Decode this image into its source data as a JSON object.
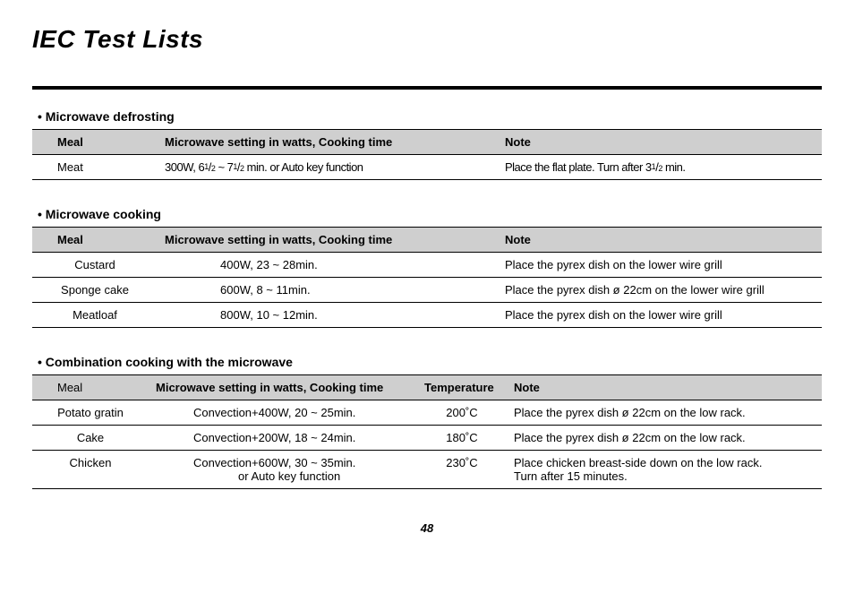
{
  "title": "IEC Test Lists",
  "page_number": "48",
  "sections": [
    {
      "heading": "• Microwave defrosting",
      "columns": [
        "Meal",
        "Microwave setting in watts, Cooking time",
        "Note"
      ],
      "rows": [
        {
          "meal": "Meat",
          "setting": "300W, 6½ ~ 7½ min. or Auto key function",
          "note": "Place the flat plate. Turn after 3½ min."
        }
      ]
    },
    {
      "heading": "• Microwave cooking",
      "columns": [
        "Meal",
        "Microwave setting in watts, Cooking time",
        "Note"
      ],
      "rows": [
        {
          "meal": "Custard",
          "setting": "400W, 23 ~ 28min.",
          "note": "Place the pyrex dish on the lower wire grill"
        },
        {
          "meal": "Sponge cake",
          "setting": "600W,  8 ~ 11min.",
          "note": "Place the pyrex dish ø 22cm on the lower wire grill"
        },
        {
          "meal": "Meatloaf",
          "setting": "800W, 10 ~ 12min.",
          "note": "Place the pyrex dish on the lower wire grill"
        }
      ]
    },
    {
      "heading": "• Combination cooking with the microwave",
      "columns": [
        "Meal",
        "Microwave setting in watts, Cooking time",
        "Temperature",
        "Note"
      ],
      "rows": [
        {
          "meal": "Potato gratin",
          "setting": "Convection+400W, 20 ~ 25min.",
          "temp": "200˚C",
          "note": "Place the pyrex dish ø 22cm on the low rack."
        },
        {
          "meal": "Cake",
          "setting": "Convection+200W, 18 ~ 24min.",
          "temp": "180˚C",
          "note": "Place the pyrex dish ø 22cm on the low rack."
        },
        {
          "meal": "Chicken",
          "setting": "Convection+600W, 30 ~ 35min.",
          "setting2": "or Auto key function",
          "temp": "230˚C",
          "note": "Place chicken breast-side down on the low rack.",
          "note2": "Turn after 15 minutes."
        }
      ]
    }
  ]
}
